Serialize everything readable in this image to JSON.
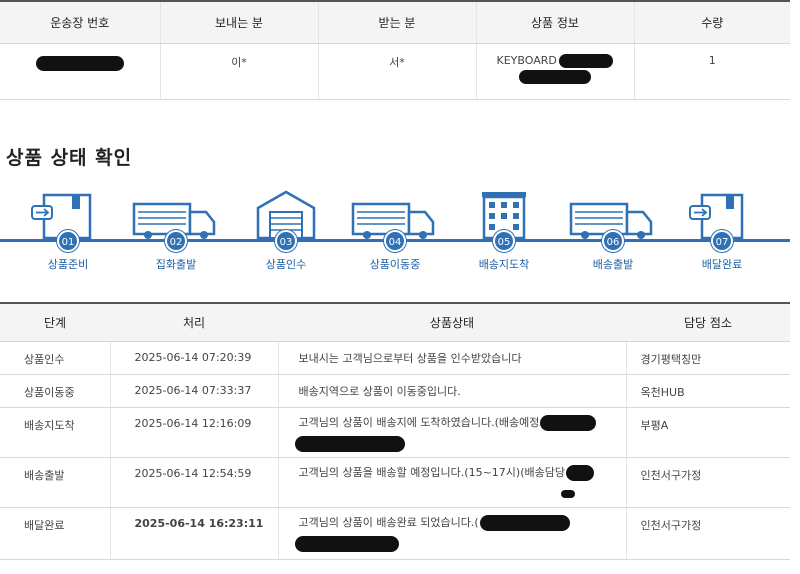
{
  "shipment": {
    "headers": [
      "운송장 번호",
      "보내는 분",
      "받는 분",
      "상품 정보",
      "수량"
    ],
    "sender": "이*",
    "receiver": "서*",
    "product": "KEYBOARD",
    "quantity": "1"
  },
  "status_title": "상품 상태 확인",
  "steps": [
    {
      "num": "01",
      "label": "상품준비",
      "icon": "box-icon"
    },
    {
      "num": "02",
      "label": "집화출발",
      "icon": "truck-icon"
    },
    {
      "num": "03",
      "label": "상품인수",
      "icon": "warehouse-icon"
    },
    {
      "num": "04",
      "label": "상품이동중",
      "icon": "truck-icon"
    },
    {
      "num": "05",
      "label": "배송지도착",
      "icon": "building-icon"
    },
    {
      "num": "06",
      "label": "배송출발",
      "icon": "truck-icon"
    },
    {
      "num": "07",
      "label": "배달완료",
      "icon": "box-icon"
    }
  ],
  "history": {
    "headers": [
      "단계",
      "처리",
      "상품상태",
      "담당 점소"
    ],
    "rows": [
      {
        "step": "상품인수",
        "time": "2025-06-14 07:20:39",
        "status": "보내시는 고객님으로부터 상품을 인수받았습니다",
        "office": "경기평택칭만"
      },
      {
        "step": "상품이동중",
        "time": "2025-06-14 07:33:37",
        "status": "배송지역으로 상품이 이동중입니다.",
        "office": "옥천HUB"
      },
      {
        "step": "배송지도착",
        "time": "2025-06-14 12:16:09",
        "status": "고객님의 상품이 배송지에 도착하였습니다.(배송예정",
        "office": "부평A"
      },
      {
        "step": "배송출발",
        "time": "2025-06-14 12:54:59",
        "status": "고객님의 상품을 배송할 예정입니다.(15~17시)(배송담당",
        "office": "인천서구가정"
      },
      {
        "step": "배달완료",
        "time": "2025-06-14 16:23:11",
        "status": "고객님의 상품이 배송완료 되었습니다.(",
        "office": "인천서구가정"
      }
    ]
  },
  "colors": {
    "accent": "#2f71b4",
    "redaction": "#111111"
  }
}
